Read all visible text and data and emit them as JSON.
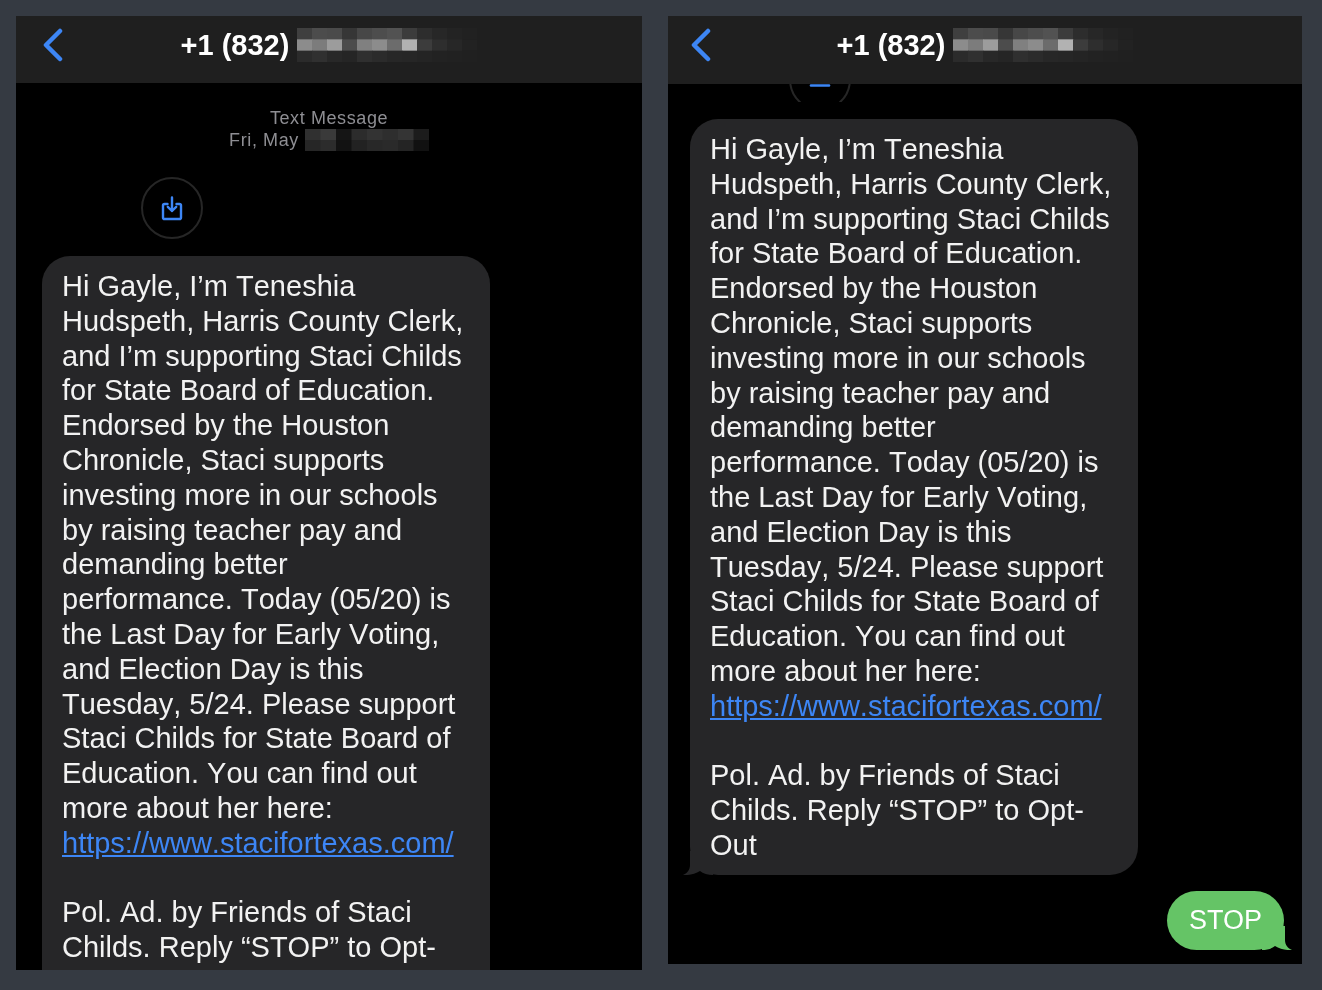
{
  "screens": [
    {
      "header": {
        "title": "+1 (832)",
        "title_redacted": true
      },
      "timestamp": {
        "service": "Text Message",
        "date": "Fri, May",
        "date_redacted": true
      },
      "messages": [
        {
          "kind": "attachment",
          "clipped": false
        },
        {
          "kind": "incoming",
          "cut": true,
          "paragraphs": [
            {
              "text": "Hi Gayle, I’m Teneshia Hudspeth, Harris County Clerk, and I’m supporting Staci Childs for State Board of Education. Endorsed by the Houston Chronicle, Staci supports investing more in our schools by raising teacher pay and demanding better performance. Today (05/20) is the Last Day for Early Voting, and Election Day is this Tuesday, 5/24. Please support Staci Childs for State Board of Education. You can find out more about her here:",
              "link": "https://www.stacifortexas.com/"
            },
            {
              "text": "Pol. Ad. by Friends of Staci Childs. Reply “STOP” to Opt-"
            }
          ]
        }
      ]
    },
    {
      "header": {
        "title": "+1 (832)",
        "title_redacted": true
      },
      "messages": [
        {
          "kind": "attachment",
          "clipped": true
        },
        {
          "kind": "incoming",
          "cut": false,
          "paragraphs": [
            {
              "text": "Hi Gayle, I’m Teneshia Hudspeth, Harris County Clerk, and I’m supporting Staci Childs for State Board of Education. Endorsed by the Houston Chronicle, Staci supports investing more in our schools by raising teacher pay and demanding better performance. Today (05/20) is the Last Day for Early Voting, and Election Day is this Tuesday, 5/24. Please support Staci Childs for State Board of Education. You can find out more about her here:",
              "link": "https://www.stacifortexas.com/"
            },
            {
              "text": "Pol. Ad. by Friends of Staci Childs. Reply “STOP” to Opt-Out"
            }
          ]
        },
        {
          "kind": "outgoing",
          "text": "STOP"
        }
      ]
    }
  ]
}
